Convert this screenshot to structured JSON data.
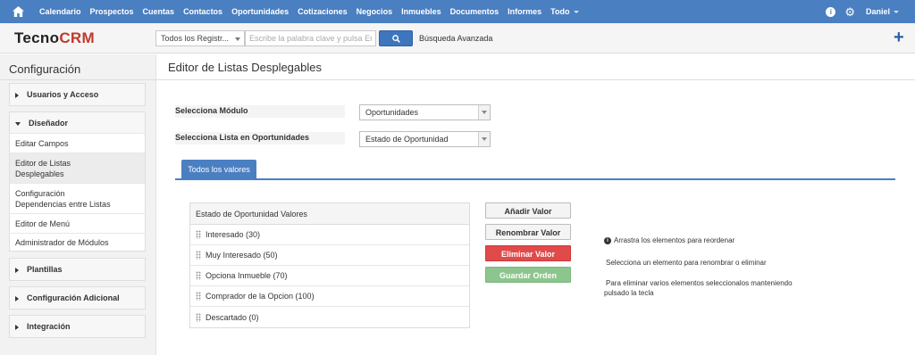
{
  "nav": {
    "items": [
      "Calendario",
      "Prospectos",
      "Cuentas",
      "Contactos",
      "Oportunidades",
      "Cotizaciones",
      "Negocios",
      "Inmuebles",
      "Documentos",
      "Informes"
    ],
    "todo": "Todo",
    "user": "Daniel"
  },
  "header": {
    "logo_a": "Tecno",
    "logo_b": "CRM",
    "module_selector": "Todos los Registr...",
    "search_placeholder": "Escribe la palabra clave y pulsa Enter",
    "advanced_search": "Búsqueda Avanzada"
  },
  "sidebar": {
    "title": "Configuración",
    "sections": {
      "usuarios": "Usuarios y Acceso",
      "disenador": "Diseñador",
      "plantillas": "Plantillas",
      "config_adicional": "Configuración Adicional",
      "integracion": "Integración"
    },
    "disenador_items": {
      "editar_campos": "Editar Campos",
      "editor_listas_1": "Editor de Listas",
      "editor_listas_2": "Desplegables",
      "config_dep_1": "Configuración",
      "config_dep_2": "Dependencias entre Listas",
      "editor_menu": "Editor de Menú",
      "admin_modulos": "Administrador de Módulos"
    }
  },
  "main": {
    "title": "Editor de Listas Desplegables",
    "module_label": "Selecciona Módulo",
    "module_value": "Oportunidades",
    "list_label": "Selecciona Lista en Oportunidades",
    "list_value": "Estado de Oportunidad",
    "tab_label": "Todos los valores",
    "list_header": "Estado de Oportunidad Valores",
    "values": [
      "Interesado (30)",
      "Muy Interesado (50)",
      "Opciona Inmueble (70)",
      "Comprador de la Opcion (100)",
      "Descartado (0)"
    ],
    "buttons": {
      "add": "Añadir Valor",
      "rename": "Renombrar Valor",
      "delete": "Eliminar Valor",
      "save_order": "Guardar Orden"
    },
    "help": {
      "reorder": "Arrastra los elementos para reordenar",
      "select": "Selecciona un elemento para renombrar o eliminar",
      "multi_1": "Para eliminar varios elementos seleccionalos manteniendo",
      "multi_2": "pulsado la tecla"
    }
  }
}
